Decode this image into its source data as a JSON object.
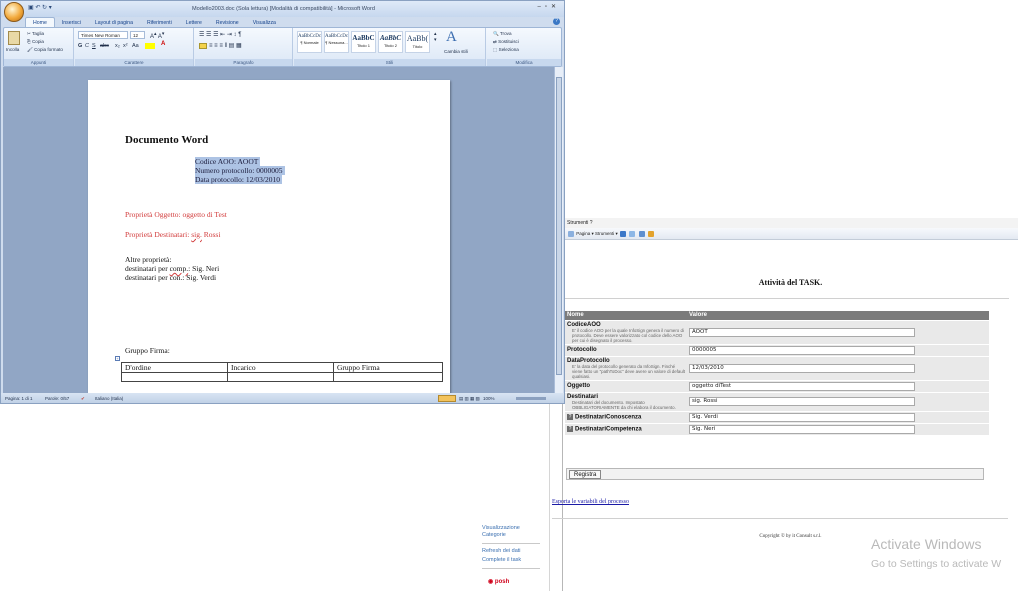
{
  "word": {
    "title": "Modello2003.doc (Sola lettura) [Modalità di compatibilità] - Microsoft Word",
    "tabs": [
      "Home",
      "Inserisci",
      "Layout di pagina",
      "Riferimenti",
      "Lettere",
      "Revisione",
      "Visualizza"
    ],
    "clipboard": {
      "incolla": "Incolla",
      "taglia": "Taglia",
      "copia": "Copia",
      "copia_formato": "Copia formato",
      "label": "Appunti"
    },
    "font": {
      "name": "Times New Roman",
      "size": "12",
      "label": "Carattere"
    },
    "paragraph_label": "Paragrafo",
    "styles": [
      {
        "sample": "AaBbCcDc",
        "name": "¶ Normale"
      },
      {
        "sample": "AaBbCcDc",
        "name": "¶ Nessuna..."
      },
      {
        "sample": "AaBbC",
        "name": "Titolo 1"
      },
      {
        "sample": "AaBbC",
        "name": "Titolo 2"
      },
      {
        "sample": "AaBb(",
        "name": "Titolo"
      }
    ],
    "styles_label": "Stili",
    "cambia_stili": "Cambia stili",
    "editing": {
      "trova": "Trova",
      "sostituisci": "Sostituisci",
      "seleziona": "Seleziona",
      "label": "Modifica"
    },
    "doc": {
      "heading": "Documento Word",
      "codice_label": "Codice AOO:",
      "codice_value": "AOOT",
      "numero_label": "Numero protocollo:",
      "numero_value": "0000005",
      "data_label": "Data protocollo:",
      "data_value": "12/03/2010",
      "prop_oggetto": "Proprietà Oggetto: oggetto di Test",
      "prop_destinatari_pre": "Proprietà Destinatari: ",
      "prop_destinatari_sig": "sig.",
      "prop_destinatari_post": " Rossi",
      "altre": "Altre proprietà:",
      "dest_comp_pre": "destinatari per ",
      "dest_comp_ul": "comp.",
      "dest_comp_post": ": Sig. Neri",
      "dest_con": "destinatari per con.: Sig. Verdi",
      "gruppo_firma": "Gruppo Firma:",
      "table_headers": [
        "D'ordine",
        "Incarico",
        "Gruppo Firma"
      ]
    },
    "status": {
      "pagina": "Pagina: 1 di 1",
      "parole": "Parole: 0/57",
      "lingua": "Italiano (Italia)",
      "zoom": "100%"
    }
  },
  "web": {
    "menu": "Strumenti ?",
    "toolbar": "Pagina ▾ Strumenti ▾",
    "title": "Attività del TASK.",
    "col_nome": "Nome",
    "col_valore": "Valore",
    "rows": [
      {
        "name": "CodiceAOO",
        "desc": "E' il codice AOO per la quale InfoSign genera il numero di protocollo. Deve essere valorizzato col codice dello AOO per cui è disegnato il processo.",
        "value": "AOOT"
      },
      {
        "name": "Protocollo",
        "desc": "",
        "value": "0000005"
      },
      {
        "name": "DataProtocollo",
        "desc": "E' la data del protocollo generato da InfoSign. Finché viene fatto un \"pathToDoc\" deve avere un valore di default qualsiasi.",
        "value": "12/03/2010"
      },
      {
        "name": "Oggetto",
        "desc": "",
        "value": "oggetto diTest"
      },
      {
        "name": "Destinatari",
        "desc": "Destinatari del documento. Impostato OBBLIGATORIAMENTE da chi elabora il documento.",
        "value": "sig. Rossi"
      },
      {
        "name": "DestinatariConoscenza",
        "desc": "",
        "value": "Sig. Verdi"
      },
      {
        "name": "DestinatariCompetenza",
        "desc": "",
        "value": "Sig. Neri"
      }
    ],
    "registra": "Registra",
    "export": "Esporta le variabili del processo",
    "copyright": "Copyright © by it Consult s.r.l.",
    "sidebar": [
      "Visualizzazione",
      "Categorie",
      "Refresh dei dati",
      "Complete il task"
    ],
    "posh": "posh"
  },
  "activate": {
    "line1": "Activate Windows",
    "line2": "Go to Settings to activate W"
  }
}
